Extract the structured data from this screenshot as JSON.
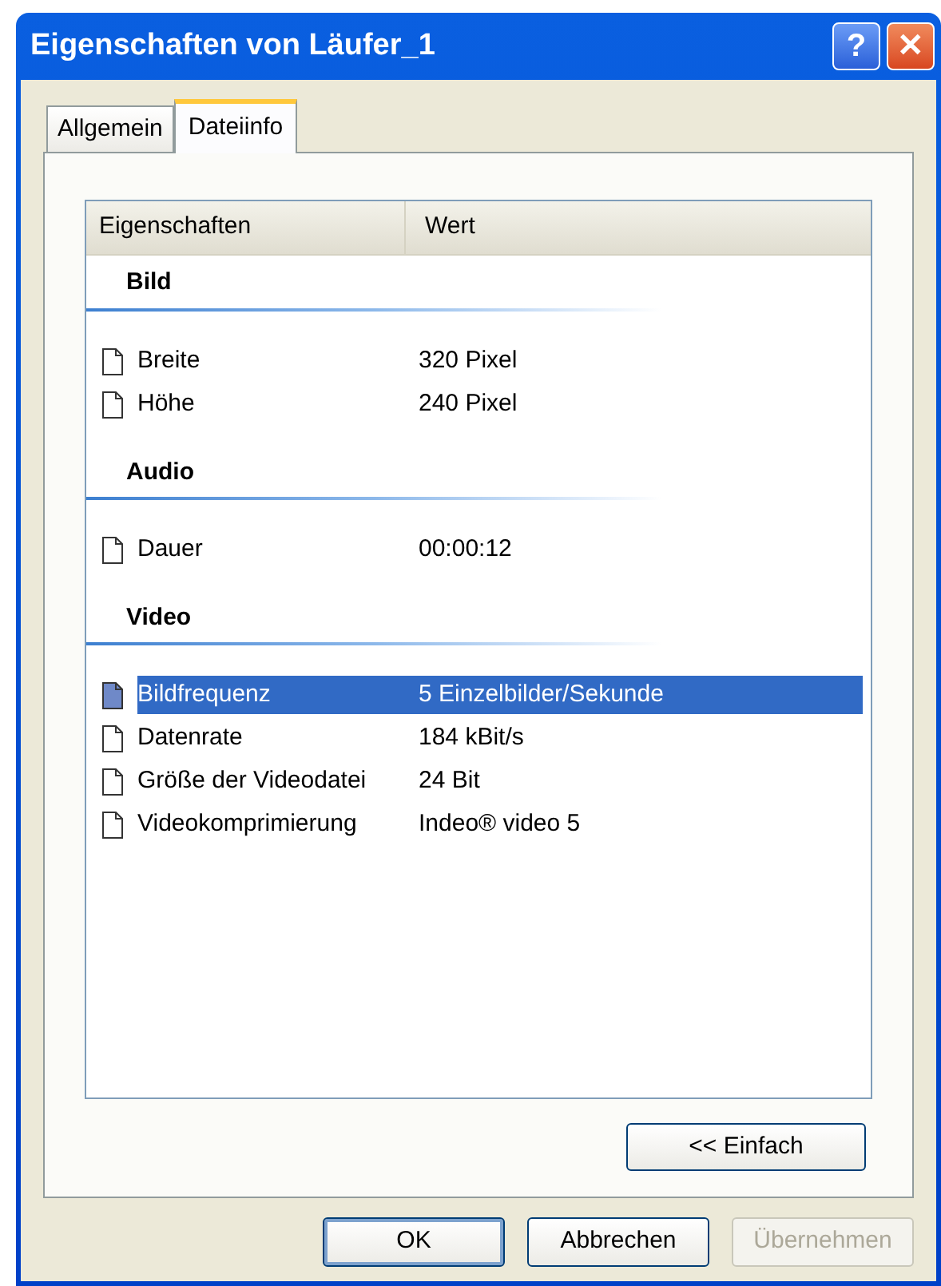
{
  "window": {
    "title": "Eigenschaften von Läufer_1",
    "title_buttons": [
      {
        "kind": "help",
        "label": "?"
      },
      {
        "kind": "close",
        "label": "✕"
      }
    ]
  },
  "tabs": [
    {
      "label": "Allgemein",
      "selected": false
    },
    {
      "label": "Dateiinfo",
      "selected": true
    }
  ],
  "list": {
    "columns": [
      "Eigenschaften",
      "Wert"
    ],
    "groups": [
      {
        "title": "Bild",
        "items": [
          {
            "name": "Breite",
            "value": "320 Pixel",
            "selected": false
          },
          {
            "name": "Höhe",
            "value": "240 Pixel",
            "selected": false
          }
        ]
      },
      {
        "title": "Audio",
        "items": [
          {
            "name": "Dauer",
            "value": "00:00:12",
            "selected": false
          }
        ]
      },
      {
        "title": "Video",
        "items": [
          {
            "name": "Bildfrequenz",
            "value": "5 Einzelbilder/Sekunde",
            "selected": true
          },
          {
            "name": "Datenrate",
            "value": "184 kBit/s",
            "selected": false
          },
          {
            "name": "Größe der Videodatei",
            "value": "24 Bit",
            "selected": false
          },
          {
            "name": "Videokomprimierung",
            "value": "Indeo® video 5",
            "selected": false
          }
        ]
      }
    ]
  },
  "toggle_button": {
    "label": "<< Einfach"
  },
  "buttons": [
    {
      "label": "OK",
      "default": true,
      "disabled": false
    },
    {
      "label": "Abbrechen",
      "default": false,
      "disabled": false
    },
    {
      "label": "Übernehmen",
      "default": false,
      "disabled": true
    }
  ]
}
